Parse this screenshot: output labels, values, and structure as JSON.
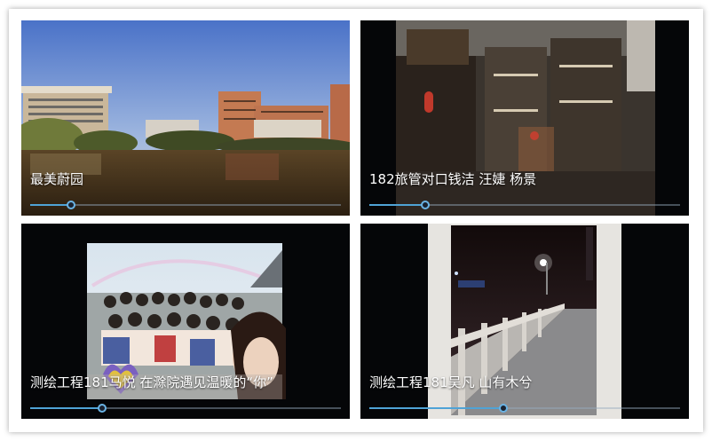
{
  "videos": [
    {
      "title": "最美蔚园",
      "progress": 0.13
    },
    {
      "title": "182旅管对口钱洁 汪婕 杨景",
      "progress": 0.18
    },
    {
      "title": "测绘工程181马悦  在滁院遇见温暖的“你”",
      "progress": 0.23
    },
    {
      "title": "测绘工程181吴凡  山有木兮",
      "progress": 0.43
    }
  ],
  "colors": {
    "progress_fill": "#4fa3d6",
    "progress_track": "#8aa0b4",
    "tile_background": "#050608"
  }
}
